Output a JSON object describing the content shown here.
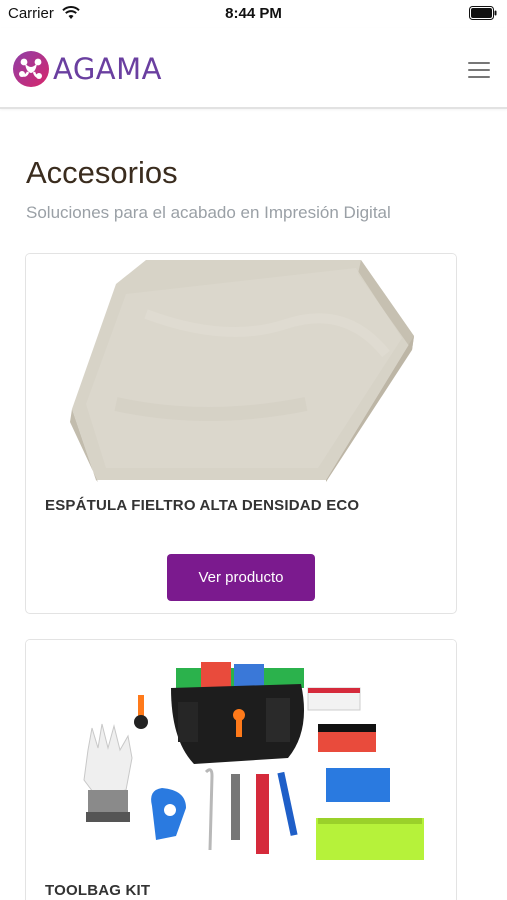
{
  "status_bar": {
    "carrier": "Carrier",
    "time": "8:44 PM"
  },
  "navbar": {
    "brand_name": "AGAMA",
    "brand_color": "#6a3fa0"
  },
  "page": {
    "title": "Accesorios",
    "subtitle": "Soluciones para el acabado en Impresión Digital"
  },
  "products": [
    {
      "name": "ESPÁTULA FIELTRO ALTA DENSIDAD ECO",
      "button_label": "Ver producto",
      "image": "felt-squeegee-image"
    },
    {
      "name": "TOOLBAG KIT",
      "image": "toolbag-kit-image"
    }
  ],
  "colors": {
    "button": "#7b1a8e",
    "title": "#3a2c1e",
    "subtitle": "#9aa0a6"
  }
}
